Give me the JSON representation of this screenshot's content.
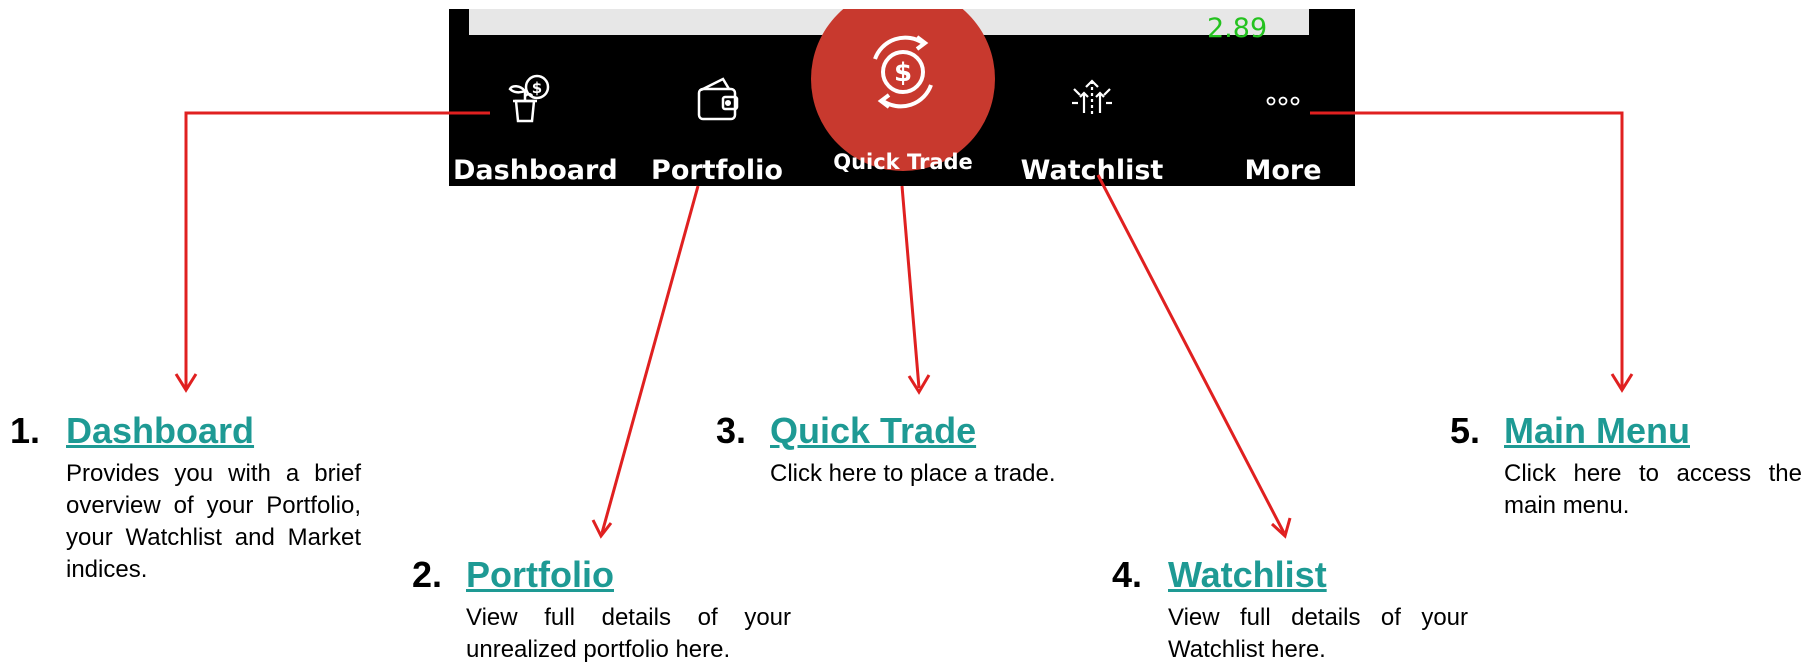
{
  "colors": {
    "screen_bg": "#000000",
    "accent_red": "#c8392e",
    "arrow": "#e02020",
    "title_teal": "#1e9a94",
    "positive_green": "#24c21f"
  },
  "screen": {
    "top_value": "2.89",
    "nav": [
      {
        "label": "Dashboard",
        "icon": "plant-coin-icon"
      },
      {
        "label": "Portfolio",
        "icon": "wallet-icon"
      },
      {
        "label": "Quick Trade",
        "icon": "dollar-cycle-icon"
      },
      {
        "label": "Watchlist",
        "icon": "rising-arrows-icon"
      },
      {
        "label": "More",
        "icon": "ellipsis-icon"
      }
    ]
  },
  "callouts": [
    {
      "number": "1.",
      "title": "Dashboard",
      "description": "Provides you with a brief overview of your Portfolio, your Watchlist and Market indices."
    },
    {
      "number": "2.",
      "title": "Portfolio",
      "description": "View full details of your unrealized portfolio here."
    },
    {
      "number": "3.",
      "title": "Quick Trade",
      "description": "Click here to place a trade."
    },
    {
      "number": "4.",
      "title": "Watchlist",
      "description": "View full details of your Watchlist here."
    },
    {
      "number": "5.",
      "title": "Main Menu",
      "description": "Click here to access the main menu."
    }
  ]
}
